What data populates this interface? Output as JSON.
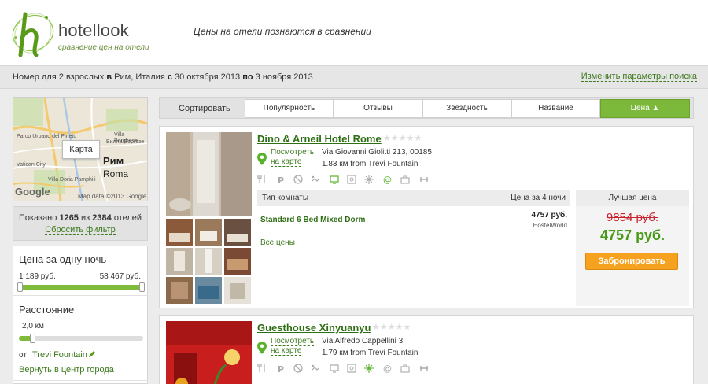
{
  "header": {
    "logo_name": "hotellook",
    "logo_sub": "сравнение цен на отели",
    "tagline": "Цены на отели познаются в сравнении"
  },
  "search": {
    "p1": "Номер для 2 взрослых",
    "w1": "в",
    "p2": "Рим, Италия",
    "w2": "с",
    "p3": "30 октября 2013",
    "w3": "по",
    "p4": "3 ноября 2013",
    "change": "Изменить параметры поиска"
  },
  "map": {
    "button": "Карта",
    "city_ru": "Рим",
    "city_en": "Roma",
    "google": "Google",
    "credit": "Map data ©2013 Google",
    "labels": [
      "Parco Urbano del Pineto",
      "Villa Borghese",
      "Вилла Боргезе",
      "Villa Doria Pamphili",
      "Vatican City"
    ]
  },
  "shown": {
    "prefix": "Показано",
    "count": "1265",
    "mid": "из",
    "total": "2384",
    "suffix": "отелей",
    "reset": "Сбросить фильтр"
  },
  "filters": {
    "price_title": "Цена за одну ночь",
    "price_min": "1 189 руб.",
    "price_max": "58 467 руб.",
    "dist_title": "Расстояние",
    "dist_value": "2,0 км",
    "from_label": "от",
    "from_place": "Trevi Fountain",
    "center_link": "Вернуть в центр города"
  },
  "sort": {
    "label": "Сортировать",
    "tabs": [
      "Популярность",
      "Отзывы",
      "Звездность",
      "Название",
      "Цена ▲"
    ]
  },
  "hotels": [
    {
      "name": "Dino & Arneil Hotel Rome",
      "map_link": "Посмотреть на карте",
      "address": "Via Giovanni Giolitti 213, 00185",
      "distance": "1.83 км from Trevi Fountain",
      "room_type_label": "Тип комнаты",
      "price_for_label": "Цена за 4 ночи",
      "room": "Standard 6 Bed Mixed Dorm",
      "room_price": "4757 руб.",
      "room_site": "HostelWorld",
      "all_prices": "Все цены",
      "best_label": "Лучшая цена",
      "old_price": "9854 руб.",
      "new_price": "4757 руб.",
      "book": "Забронировать"
    },
    {
      "name": "Guesthouse Xinyuanyu",
      "map_link": "Посмотреть на карте",
      "address": "Via Alfredo Cappellini 3",
      "distance": "1.79 км from Trevi Fountain"
    }
  ],
  "colors": {
    "accent_green": "#7cb83a",
    "link_green": "#2f6f14",
    "old_price_red": "#c8242f",
    "book_orange": "#f6a21e"
  }
}
